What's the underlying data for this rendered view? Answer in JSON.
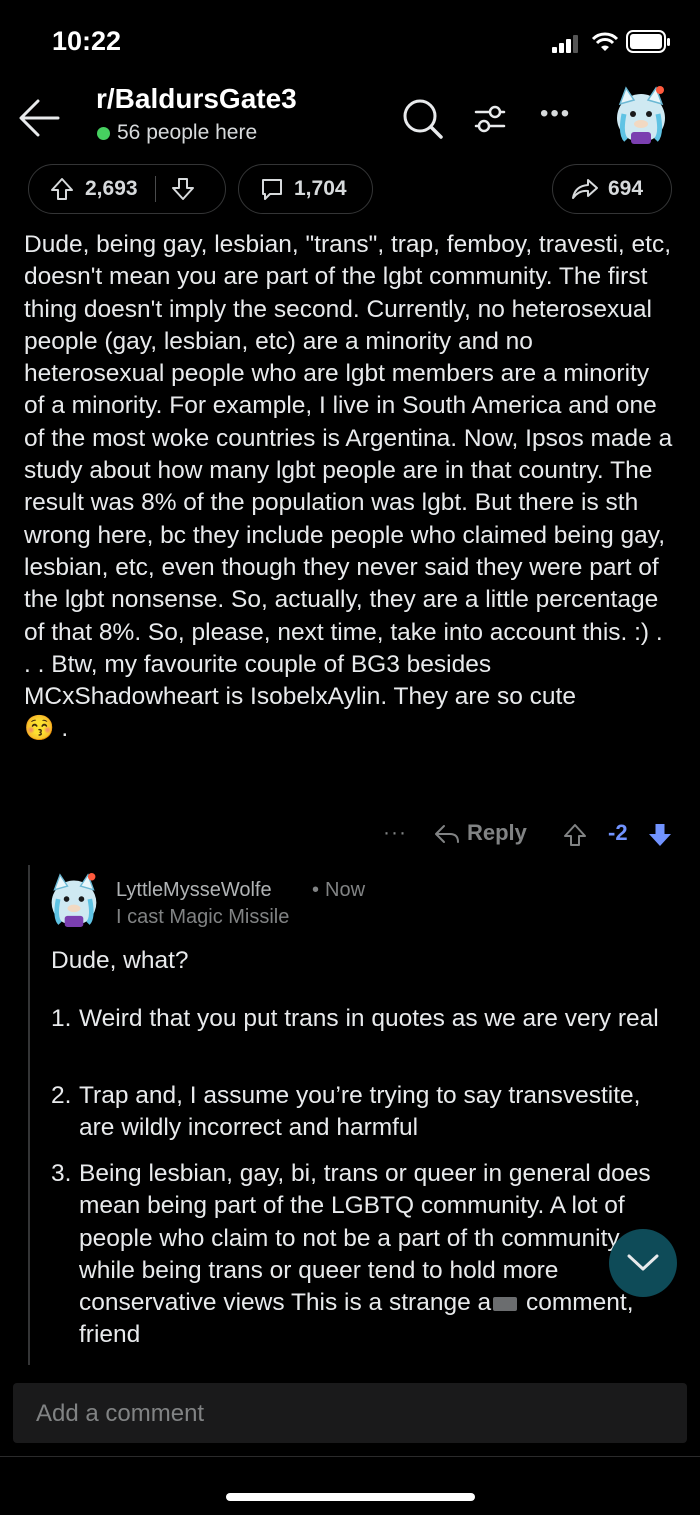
{
  "status_bar": {
    "time": "10:22"
  },
  "header": {
    "subreddit": "r/BaldursGate3",
    "online": "56 people here"
  },
  "actions": {
    "upvotes": "2,693",
    "comments": "1,704",
    "shares": "694"
  },
  "post": {
    "body": "Dude, being gay, lesbian, \"trans\", trap, femboy, travesti, etc, doesn't mean you are part of the lgbt community. The first thing doesn't imply the second. Currently, no heterosexual people (gay, lesbian, etc) are a minority and no heterosexual people who are lgbt members are a minority of a minority. For example, I live in South America and one of the most woke countries is Argentina. Now, Ipsos made a study about how many lgbt people are in that country. The result was 8% of the population was lgbt. But there is sth wrong here, bc they include people who claimed being gay, lesbian, etc, even though they never said they were part of the lgbt nonsense. So, actually, they are a little percentage of that 8%. So, please, next time, take into account this. :) . . . Btw, my favourite couple of BG3 besides MCxShadowheart is IsobelxAylin. They are so cute",
    "emoji": "😚",
    "end": " .",
    "more": "···",
    "reply_label": "Reply",
    "score": "-2"
  },
  "reply": {
    "author": "LyttleMysseWolfe",
    "separator": "•",
    "time": "Now",
    "flair": "I cast Magic Missile",
    "opening": "Dude, what?",
    "items": [
      {
        "num": "1.",
        "text": "Weird that you put trans in quotes as we are very real"
      },
      {
        "num": "2.",
        "text": "Trap and, I assume you’re trying to say transvestite, are wildly incorrect and harmful"
      },
      {
        "num": "3.",
        "text_a": "Being lesbian, gay, bi, trans or queer in general does mean being part of the LGBTQ community. A lot of people who claim to not be a part of th community while being trans or queer tend to hold more conservative views This is a strange a",
        "text_b": " comment, friend"
      }
    ]
  },
  "composer": {
    "placeholder": "Add a comment"
  },
  "colors": {
    "background": "#000000",
    "online_dot": "#46d160",
    "score_blue": "#7193ff",
    "jump_button": "#0e4b58"
  }
}
